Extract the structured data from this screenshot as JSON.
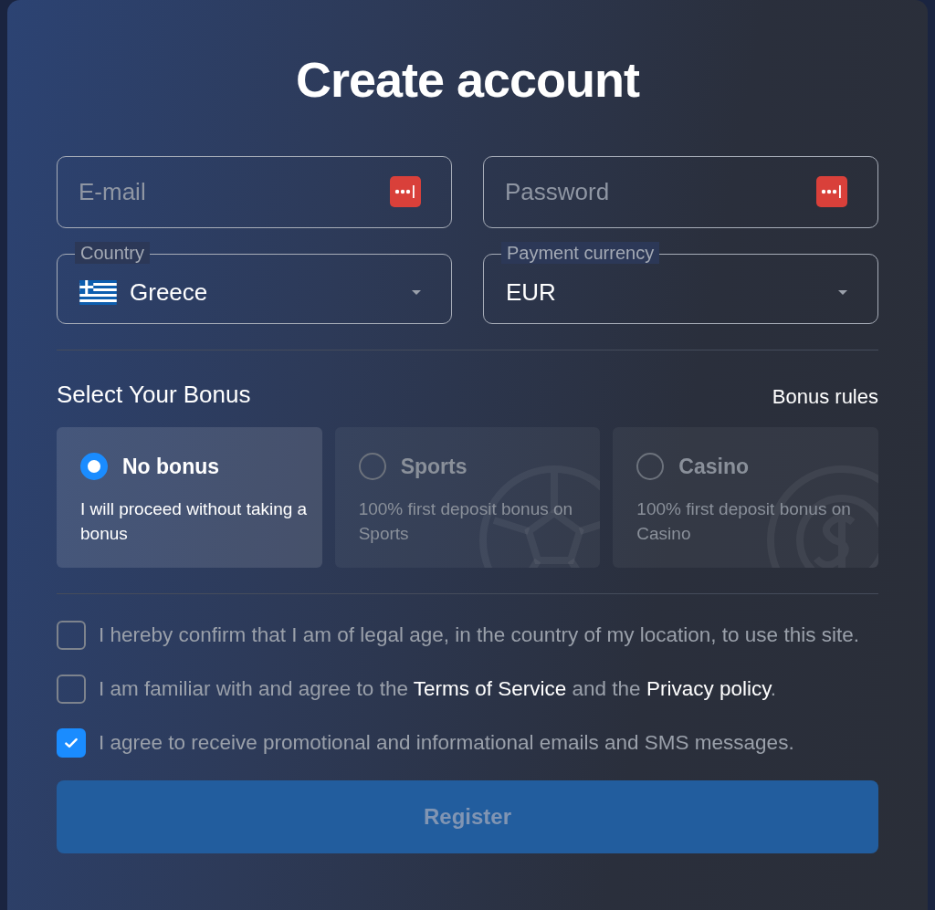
{
  "title": "Create account",
  "fields": [
    {
      "placeholder": "E-mail"
    },
    {
      "placeholder": "Password"
    }
  ],
  "selects": [
    {
      "label": "Country",
      "value": "Greece",
      "flag": true
    },
    {
      "label": "Payment currency",
      "value": "EUR",
      "flag": false
    }
  ],
  "bonus": {
    "heading": "Select Your Bonus",
    "rules_link": "Bonus rules",
    "options": [
      {
        "title": "No bonus",
        "description": "I will proceed without taking a bonus",
        "selected": true,
        "kind": "none"
      },
      {
        "title": "Sports",
        "description": "100% first deposit bonus on Sports",
        "selected": false,
        "kind": "sports"
      },
      {
        "title": "Casino",
        "description": "100% first deposit bonus on Casino",
        "selected": false,
        "kind": "casino"
      }
    ]
  },
  "consents": [
    {
      "checked": false,
      "parts": [
        {
          "kind": "plain",
          "text": "I hereby confirm that I am of legal age, in the country of my location, to use this site."
        }
      ]
    },
    {
      "checked": false,
      "parts": [
        {
          "kind": "plain",
          "text": "I am familiar with and agree to the "
        },
        {
          "kind": "link",
          "text": "Terms of Service"
        },
        {
          "kind": "plain",
          "text": " and the "
        },
        {
          "kind": "link",
          "text": "Privacy policy"
        },
        {
          "kind": "plain",
          "text": "."
        }
      ]
    },
    {
      "checked": true,
      "parts": [
        {
          "kind": "plain",
          "text": "I agree to receive promotional and informational emails and SMS messages."
        }
      ]
    }
  ],
  "submit": {
    "label": "Register",
    "disabled": true
  }
}
